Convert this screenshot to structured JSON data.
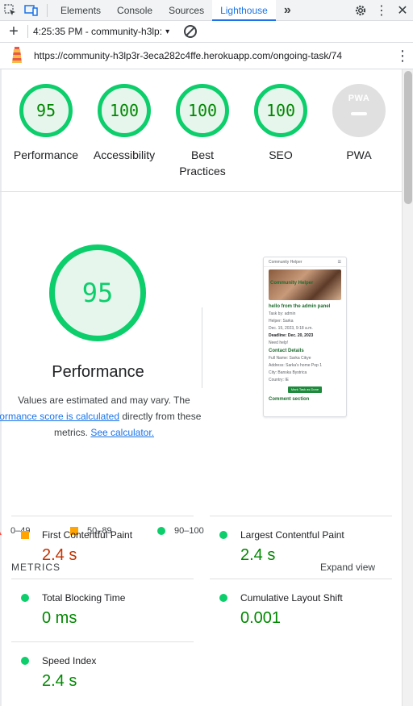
{
  "devtools": {
    "tabs": [
      "Elements",
      "Console",
      "Sources",
      "Lighthouse"
    ],
    "active_tab": "Lighthouse",
    "more_tabs": "»"
  },
  "report_bar": {
    "add_label": "+",
    "report_select": "4:25:35 PM - community-h3lp:",
    "caret": "▾"
  },
  "url_bar": {
    "url": "https://community-h3lp3r-3eca282c4ffe.herokuapp.com/ongoing-task/74",
    "menu": "⋮"
  },
  "gauges": [
    {
      "score": "95",
      "label": "Performance"
    },
    {
      "score": "100",
      "label": "Accessibility"
    },
    {
      "score": "100",
      "label": "Best Practices"
    },
    {
      "score": "100",
      "label": "SEO"
    },
    {
      "score": "",
      "label": "PWA"
    }
  ],
  "pwa_badge": "PWA",
  "performance": {
    "score": "95",
    "title": "Performance",
    "est_text_1": "Values are estimated and may vary. The",
    "est_link": "performance score is calculated",
    "est_text_2": "directly from these",
    "est_text_3": "metrics.",
    "calc_link": "See calculator."
  },
  "thumbnail": {
    "brand": "Community Helper",
    "hero_text": "Community Helper",
    "heading": "hello from the admin panel",
    "line1": "Task by: admin",
    "line2": "Helper: Sarka",
    "line3": "Dec. 15, 2023, 9:18 a.m.",
    "deadline": "Deadline: Dec. 20, 2023",
    "line4": "Need help!",
    "contact_heading": "Contact Details",
    "contact1": "Full Name: Sarka Cikye",
    "contact2": "Address: Sarka's home Pop 1",
    "contact3": "City: Banska Bystrica",
    "contact4": "Country: IE",
    "button": "Mark Task as Done",
    "comment_heading": "Comment section"
  },
  "legend": {
    "fail": "0–49",
    "average": "50–89",
    "pass": "90–100"
  },
  "metrics": {
    "heading": "METRICS",
    "expand": "Expand view",
    "items": [
      {
        "name": "First Contentful Paint",
        "value": "2.4 s",
        "status": "average"
      },
      {
        "name": "Largest Contentful Paint",
        "value": "2.4 s",
        "status": "pass"
      },
      {
        "name": "Total Blocking Time",
        "value": "0 ms",
        "status": "pass"
      },
      {
        "name": "Cumulative Layout Shift",
        "value": "0.001",
        "status": "pass"
      },
      {
        "name": "Speed Index",
        "value": "2.4 s",
        "status": "pass"
      }
    ]
  },
  "colors": {
    "pass": "#0cce6b",
    "average": "#ffa400",
    "fail": "#ff4e42",
    "accent": "#1a73e8"
  }
}
